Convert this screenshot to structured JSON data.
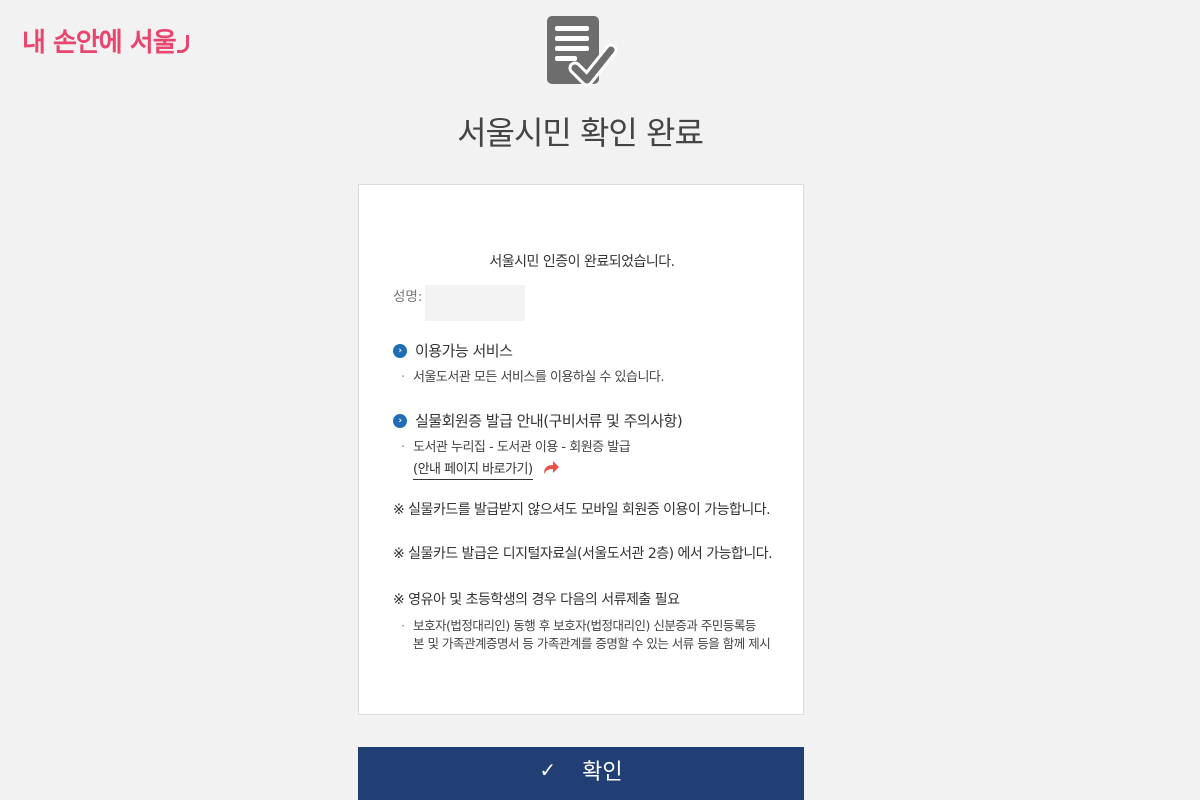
{
  "logo": {
    "text": "내 손안에 서울"
  },
  "title": "서울시민 확인 완료",
  "card": {
    "notice": "서울시민 인증이 완료되었습니다.",
    "name_label": "성명: ",
    "sections": [
      {
        "heading": "이용가능 서비스",
        "bullet": "서울도서관 모든 서비스를 이용하실 수 있습니다."
      },
      {
        "heading": "실물회원증 발급 안내(구비서류 및 주의사항)",
        "bullet": "도서관 누리집 - 도서관 이용 - 회원증 발급",
        "link": "(안내 페이지 바로가기)"
      }
    ],
    "notes": [
      "※ 실물카드를 발급받지 않으셔도 모바일 회원증 이용이 가능합니다.",
      "※ 실물카드 발급은 디지털자료실(서울도서관 2층) 에서 가능합니다.",
      "※ 영유아 및 초등학생의 경우 다음의 서류제출 필요"
    ],
    "note_bullet_line1": "보호자(법정대리인) 동행 후 보호자(법정대리인) 신분증과 주민등록등",
    "note_bullet_line2": "본 및 가족관계증명서 등 가족관계를 증명할 수 있는 서류 등을 함께 제시"
  },
  "confirm": {
    "check": "✓",
    "label": "확인"
  },
  "colors": {
    "accent": "#213f74",
    "brand": "#e8466f",
    "bullet_icon": "#1e6db5",
    "link_arrow": "#e8524a"
  },
  "icons": {
    "document": "document-check-icon",
    "chevron": "chevron-right-icon",
    "arrow": "curved-arrow-icon"
  }
}
